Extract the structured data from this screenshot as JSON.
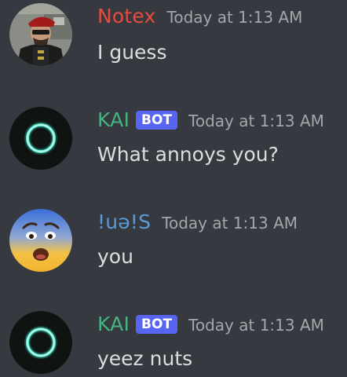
{
  "messages": [
    {
      "username": "Notex",
      "username_color": "#e84b3c",
      "timestamp": "Today at 1:13 AM",
      "text": "I guess",
      "is_bot": false,
      "avatar": "soldier-photo"
    },
    {
      "username": "KAI",
      "username_color": "#43b581",
      "bot_label": "BOT",
      "timestamp": "Today at 1:13 AM",
      "text": "What annoys you?",
      "is_bot": true,
      "avatar": "glowing-ring"
    },
    {
      "username": "!uǝ!S",
      "username_color": "#5b9bd5",
      "timestamp": "Today at 1:13 AM",
      "text": "you",
      "is_bot": false,
      "avatar": "fearful-face-emoji"
    },
    {
      "username": "KAI",
      "username_color": "#43b581",
      "bot_label": "BOT",
      "timestamp": "Today at 1:13 AM",
      "text": "yeez nuts",
      "is_bot": true,
      "avatar": "glowing-ring"
    }
  ],
  "colors": {
    "background": "#36393f",
    "message_text": "#dcddde",
    "timestamp": "#a3a6aa",
    "bot_tag": "#5865f2"
  }
}
